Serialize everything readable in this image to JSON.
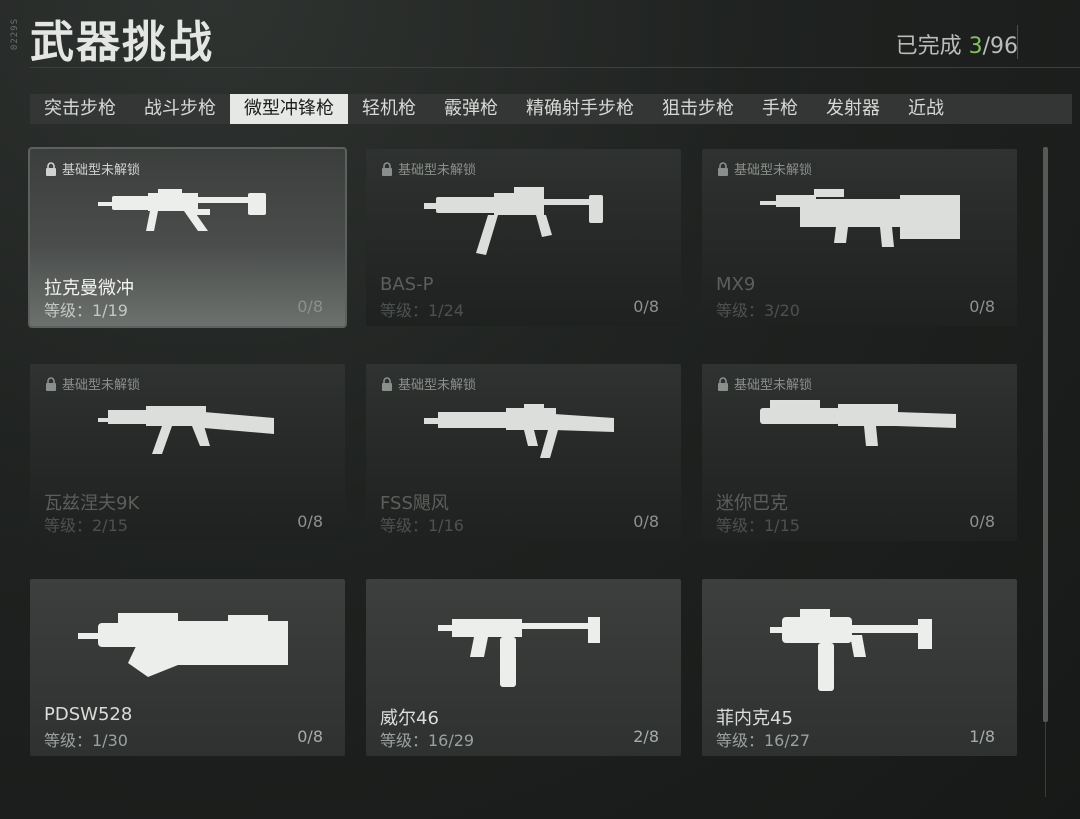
{
  "header": {
    "side_tag": "0229S",
    "title": "武器挑战",
    "progress_label": "已完成 ",
    "progress_done": "3",
    "progress_total": "/96"
  },
  "tabs": [
    {
      "label": "突击步枪",
      "active": false
    },
    {
      "label": "战斗步枪",
      "active": false
    },
    {
      "label": "微型冲锋枪",
      "active": true
    },
    {
      "label": "轻机枪",
      "active": false
    },
    {
      "label": "霰弹枪",
      "active": false
    },
    {
      "label": "精确射手步枪",
      "active": false
    },
    {
      "label": "狙击步枪",
      "active": false
    },
    {
      "label": "手枪",
      "active": false
    },
    {
      "label": "发射器",
      "active": false
    },
    {
      "label": "近战",
      "active": false
    }
  ],
  "cards": [
    {
      "lock": "基础型未解锁",
      "name": "拉克曼微冲",
      "level": "等级：1/19",
      "count": "0/8",
      "state": "selected",
      "icon": "smg-mp5-icon"
    },
    {
      "lock": "基础型未解锁",
      "name": "BAS-P",
      "level": "等级：1/24",
      "count": "0/8",
      "state": "locked",
      "icon": "smg-basp-icon"
    },
    {
      "lock": "基础型未解锁",
      "name": "MX9",
      "level": "等级：3/20",
      "count": "0/8",
      "state": "locked",
      "icon": "smg-mx9-icon"
    },
    {
      "lock": "基础型未解锁",
      "name": "瓦兹涅夫9K",
      "level": "等级：2/15",
      "count": "0/8",
      "state": "locked",
      "icon": "smg-vityaz-icon"
    },
    {
      "lock": "基础型未解锁",
      "name": "FSS飓风",
      "level": "等级：1/16",
      "count": "0/8",
      "state": "locked",
      "icon": "smg-fss-icon"
    },
    {
      "lock": "基础型未解锁",
      "name": "迷你巴克",
      "level": "等级：1/15",
      "count": "0/8",
      "state": "locked",
      "icon": "smg-bizon-icon"
    },
    {
      "lock": "",
      "name": "PDSW528",
      "level": "等级：1/30",
      "count": "0/8",
      "state": "unlocked",
      "icon": "smg-p90-icon"
    },
    {
      "lock": "",
      "name": "威尔46",
      "level": "等级：16/29",
      "count": "2/8",
      "state": "unlocked",
      "icon": "smg-mp7-icon"
    },
    {
      "lock": "",
      "name": "菲内克45",
      "level": "等级：16/27",
      "count": "1/8",
      "state": "unlocked",
      "icon": "smg-vector-icon"
    }
  ]
}
